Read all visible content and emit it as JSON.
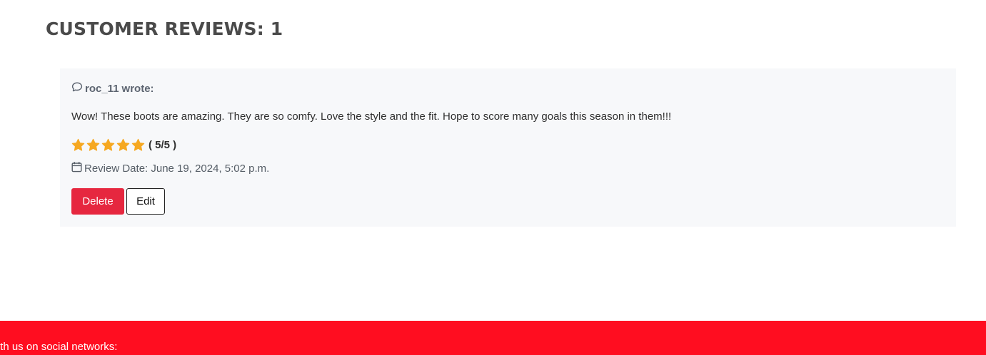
{
  "reviews_section": {
    "title": "CUSTOMER REVIEWS: 1",
    "reviews": [
      {
        "author": "roc_11",
        "author_suffix": "wrote:",
        "text": "Wow! These boots are amazing. They are so comfy. Love the style and the fit. Hope to score many goals this season in them!!!",
        "rating": 5,
        "rating_max": 5,
        "rating_label": "( 5/5 )",
        "date_label": "Review Date: June 19, 2024, 5:02 p.m.",
        "delete_label": "Delete",
        "edit_label": "Edit"
      }
    ]
  },
  "footer": {
    "social_text": "with us on social networks:"
  },
  "colors": {
    "star": "#f6a821",
    "delete_button": "#e6273f",
    "footer_background": "#ff0d20",
    "card_background": "#f7f8fa"
  },
  "icons": {
    "author": "comment-icon",
    "date": "calendar-icon",
    "rating": "star-icon"
  }
}
